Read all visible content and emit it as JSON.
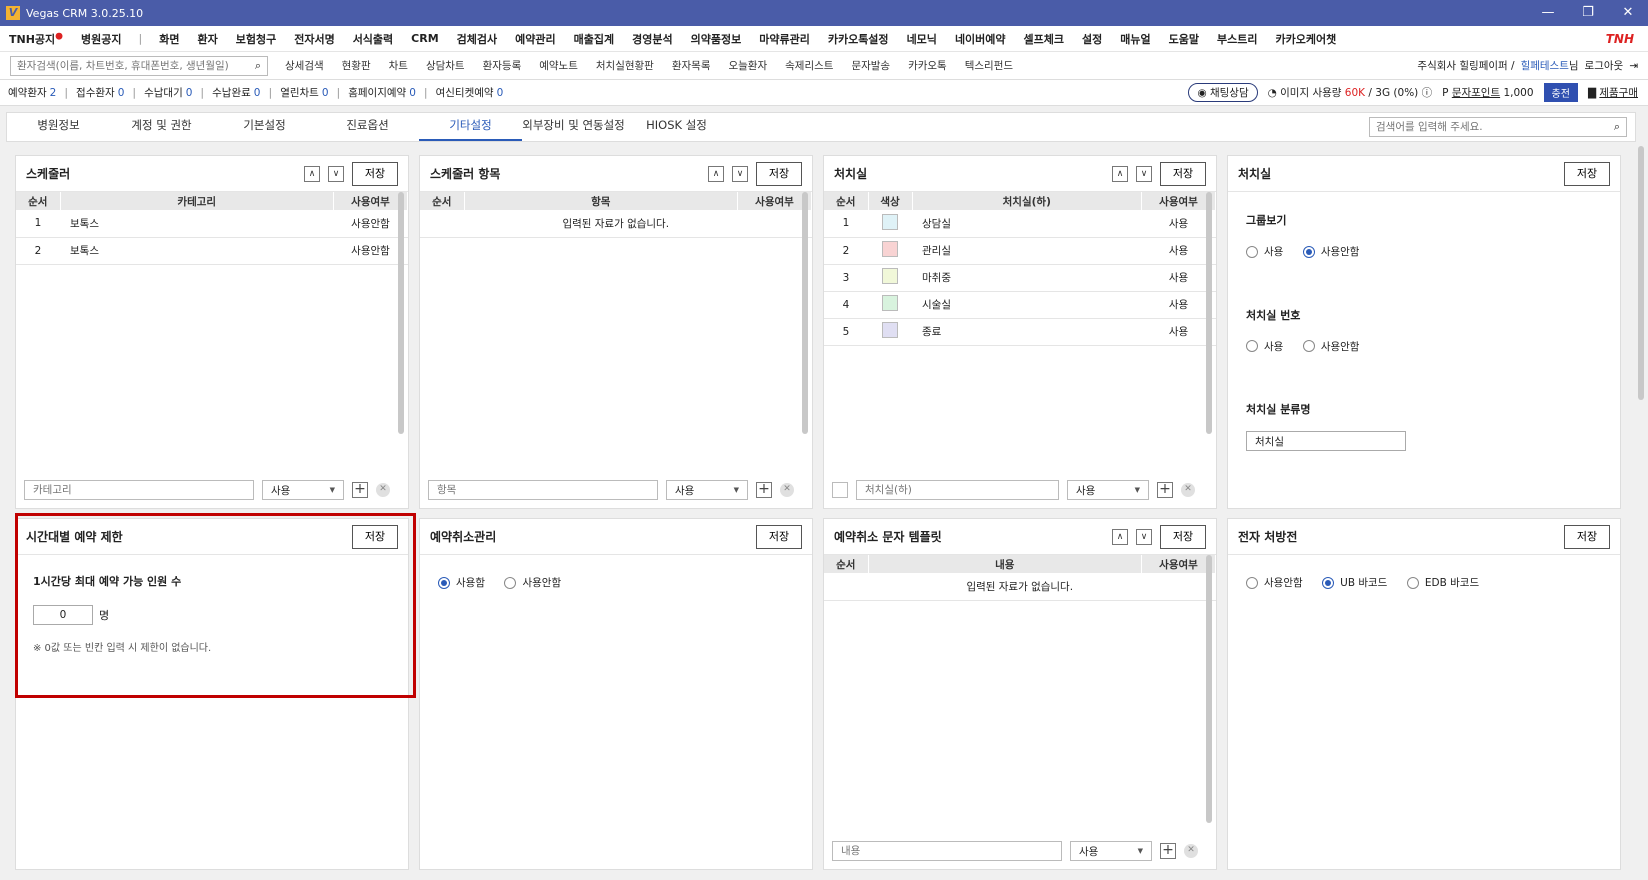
{
  "window": {
    "title": "Vegas CRM 3.0.25.10",
    "brand": "TNH",
    "minimize": "—",
    "restore": "❐",
    "close": "✕"
  },
  "menu": [
    "TNH공지",
    "병원공지",
    "화면",
    "환자",
    "보험청구",
    "전자서명",
    "서식출력",
    "CRM",
    "검체검사",
    "예약관리",
    "매출집계",
    "경영분석",
    "의약품정보",
    "마약류관리",
    "카카오톡설정",
    "네모닉",
    "네이버예약",
    "셀프체크",
    "설정",
    "매뉴얼",
    "도움말",
    "부스트리",
    "카카오케어챗"
  ],
  "menu_sep": "|",
  "toolbar": {
    "search_placeholder": "환자검색(이름, 차트번호, 휴대폰번호, 생년월일)",
    "links": [
      "상세검색",
      "현황판",
      "차트",
      "상담차트",
      "환자등록",
      "예약노트",
      "처치실현황판",
      "환자목록",
      "오늘환자",
      "속제리스트",
      "문자발송",
      "카카오톡",
      "텍스리펀드"
    ],
    "company": "주식회사 힐링페이퍼 /",
    "user": "힐페테스트",
    "user_suffix": "님",
    "logout": "로그아웃"
  },
  "status": {
    "items": [
      {
        "label": "예약환자",
        "value": "2"
      },
      {
        "label": "접수환자",
        "value": "0"
      },
      {
        "label": "수납대기",
        "value": "0"
      },
      {
        "label": "수납완료",
        "value": "0"
      },
      {
        "label": "열린차트",
        "value": "0"
      },
      {
        "label": "홈페이지예약",
        "value": "0"
      },
      {
        "label": "여신티켓예약",
        "value": "0"
      }
    ],
    "sep": "|",
    "chat": "채팅상담",
    "image_usage_label": "이미지 사용량",
    "image_usage_used": "60K",
    "image_usage_total": "/ 3G (0%)",
    "point_label": "문자포인트",
    "point_value": "1,000",
    "charge": "충전",
    "buy": "제품구매"
  },
  "tabs": [
    "병원정보",
    "계정 및 권한",
    "기본설정",
    "진료옵션",
    "기타설정",
    "외부장비 및 연동설정",
    "HIOSK 설정"
  ],
  "tab_search_placeholder": "검색어를 입력해 주세요.",
  "common": {
    "save": "저장",
    "up": "∧",
    "down": "∨",
    "use": "사용",
    "plus": "+",
    "x": "✕",
    "caret": "▼"
  },
  "scheduler": {
    "title": "스케줄러",
    "columns": [
      "순서",
      "카테고리",
      "사용여부"
    ],
    "rows": [
      {
        "order": "1",
        "category": "보톡스",
        "usage": "사용안함"
      },
      {
        "order": "2",
        "category": "보톡스",
        "usage": "사용안함"
      }
    ],
    "input_placeholder": "카테고리"
  },
  "scheduler_items": {
    "title": "스케줄러 항목",
    "columns": [
      "순서",
      "항목",
      "사용여부"
    ],
    "empty": "입력된 자료가 없습니다.",
    "input_placeholder": "항목"
  },
  "treatment_room": {
    "title": "처치실",
    "columns": [
      "순서",
      "색상",
      "처치실(하)",
      "사용여부"
    ],
    "rows": [
      {
        "order": "1",
        "color": "#dff2f7",
        "name": "상담실",
        "usage": "사용"
      },
      {
        "order": "2",
        "color": "#f8d3d3",
        "name": "관리실",
        "usage": "사용"
      },
      {
        "order": "3",
        "color": "#f1f8d9",
        "name": "마취중",
        "usage": "사용"
      },
      {
        "order": "4",
        "color": "#d8f3de",
        "name": "시술실",
        "usage": "사용"
      },
      {
        "order": "5",
        "color": "#e0dff3",
        "name": "종료",
        "usage": "사용"
      }
    ],
    "input_placeholder": "처치실(하)"
  },
  "treatment_settings": {
    "title": "처치실",
    "group_view": {
      "label": "그룹보기",
      "options": [
        "사용",
        "사용안함"
      ],
      "selected": "사용안함"
    },
    "room_number": {
      "label": "처치실 번호",
      "options": [
        "사용",
        "사용안함"
      ],
      "selected": ""
    },
    "category_name": {
      "label": "처치실 분류명",
      "value": "처치실"
    }
  },
  "time_limit": {
    "title": "시간대별 예약 제한",
    "label": "1시간당 최대 예약 가능 인원 수",
    "value": "0",
    "unit": "명",
    "note": "※ 0값 또는 빈칸 입력 시 제한이 없습니다."
  },
  "cancel_mgmt": {
    "title": "예약취소관리",
    "options": [
      "사용함",
      "사용안함"
    ],
    "selected": "사용함"
  },
  "cancel_template": {
    "title": "예약취소 문자 템플릿",
    "columns": [
      "순서",
      "내용",
      "사용여부"
    ],
    "empty": "입력된 자료가 없습니다.",
    "input_placeholder": "내용"
  },
  "e_prescription": {
    "title": "전자 처방전",
    "options": [
      "사용안함",
      "UB 바코드",
      "EDB 바코드"
    ],
    "selected": "UB 바코드"
  }
}
